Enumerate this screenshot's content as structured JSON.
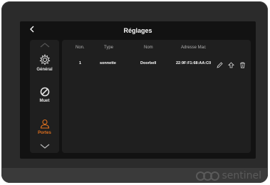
{
  "header": {
    "back_icon": "chevron-left-icon",
    "title": "Réglages"
  },
  "sidebar": {
    "items": [
      {
        "label": "Général",
        "icon": "gear-icon",
        "active": false
      },
      {
        "label": "Muet",
        "icon": "mute-icon",
        "active": false
      },
      {
        "label": "Portes",
        "icon": "user-icon",
        "active": true
      }
    ],
    "scroll_up_icon": "chevron-up-icon",
    "scroll_down_icon": "chevron-down-icon"
  },
  "table": {
    "columns": [
      "Non.",
      "Type",
      "Nom",
      "Adresse Mac"
    ],
    "rows": [
      {
        "num": "1",
        "type": "sonnette",
        "name": "Doorbell",
        "mac": "22:9F:F1:68:AA:C0"
      }
    ],
    "row_actions": [
      "edit-icon",
      "upload-icon",
      "trash-icon"
    ]
  },
  "brand": {
    "name": "sentinel"
  },
  "colors": {
    "accent": "#e0701e",
    "background": "#121212",
    "panel": "#1f1f1f"
  }
}
